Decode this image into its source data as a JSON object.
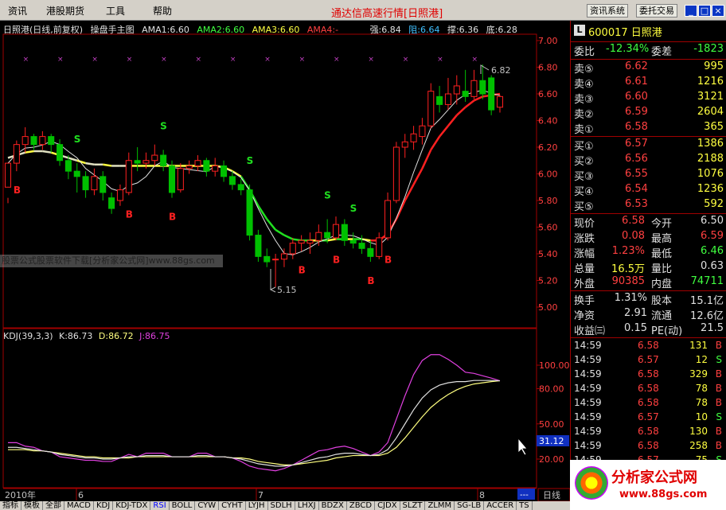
{
  "menu": {
    "items": [
      "资讯",
      "港股期货",
      "工具",
      "帮助"
    ],
    "title": "通达信高速行情[日照港]",
    "buttons": [
      "资讯系统",
      "委托交易"
    ],
    "win": [
      "_",
      "□",
      "×"
    ]
  },
  "header": {
    "name": "日照港(日线,前复权)",
    "indicator": "操盘手主图",
    "ama1": "AMA1:6.60",
    "ama2": "AMA2:6.60",
    "ama3": "AMA3:6.60",
    "ama4": "AMA4:-",
    "strong": "强:6.84",
    "resist": "阻:6.64",
    "support": "撑:6.36",
    "bottom": "底:6.28"
  },
  "watermark": "股票公式股票软件下载[分析家公式网]www.88gs.com",
  "kdj": {
    "name": "KDJ(39,3,3)",
    "k": "K:86.73",
    "d": "D:86.72",
    "j": "J:86.75"
  },
  "price_axis": [
    "7.00",
    "6.80",
    "6.60",
    "6.40",
    "6.20",
    "6.00",
    "5.80",
    "5.60",
    "5.40",
    "5.20",
    "5.00"
  ],
  "kdj_axis": [
    "100.00",
    "80.00",
    "50.00",
    "20.00"
  ],
  "kdj_readout": "31.12",
  "date_axis": [
    "2010年",
    "6",
    "7",
    "8"
  ],
  "annotations": {
    "high": "6.82",
    "low": "5.15"
  },
  "period_label": "日线",
  "more_label": "---",
  "tabs": [
    "指标",
    "模板",
    "全部",
    "MACD",
    "KDJ",
    "KDJ-TDX",
    "RSI",
    "BOLL",
    "CYW",
    "CYHT",
    "LYJH",
    "SDLH",
    "LHXJ",
    "BDZX",
    "ZBCD",
    "CJDX",
    "SLZT",
    "ZLMM",
    "SG-LB",
    "ACCER",
    "TS"
  ],
  "stock": {
    "logo": "L",
    "code_name": "600017 日照港"
  },
  "weibi": {
    "l1": "委比",
    "v1": "-12.34%",
    "l2": "委差",
    "v2": "-1823"
  },
  "sell": [
    {
      "label": "卖⑤",
      "price": "6.62",
      "vol": "995"
    },
    {
      "label": "卖④",
      "price": "6.61",
      "vol": "1216"
    },
    {
      "label": "卖③",
      "price": "6.60",
      "vol": "3121"
    },
    {
      "label": "卖②",
      "price": "6.59",
      "vol": "2604"
    },
    {
      "label": "卖①",
      "price": "6.58",
      "vol": "365"
    }
  ],
  "buy": [
    {
      "label": "买①",
      "price": "6.57",
      "vol": "1386"
    },
    {
      "label": "买②",
      "price": "6.56",
      "vol": "2188"
    },
    {
      "label": "买③",
      "price": "6.55",
      "vol": "1076"
    },
    {
      "label": "买④",
      "price": "6.54",
      "vol": "1236"
    },
    {
      "label": "买⑤",
      "price": "6.53",
      "vol": "592"
    }
  ],
  "quote": [
    {
      "l1": "现价",
      "v1": "6.58",
      "c1": "#ff4040",
      "l2": "今开",
      "v2": "6.50",
      "c2": "#e0e0e0"
    },
    {
      "l1": "涨跌",
      "v1": "0.08",
      "c1": "#ff4040",
      "l2": "最高",
      "v2": "6.59",
      "c2": "#ff4040"
    },
    {
      "l1": "涨幅",
      "v1": "1.23%",
      "c1": "#ff4040",
      "l2": "最低",
      "v2": "6.46",
      "c2": "#40ff40"
    },
    {
      "l1": "总量",
      "v1": "16.5万",
      "c1": "#ffff40",
      "l2": "量比",
      "v2": "0.63",
      "c2": "#e0e0e0"
    },
    {
      "l1": "外盘",
      "v1": "90385",
      "c1": "#ff4040",
      "l2": "内盘",
      "v2": "74711",
      "c2": "#40ff40"
    }
  ],
  "fund": [
    {
      "l1": "换手",
      "v1": "1.31%",
      "l2": "股本",
      "v2": "15.1亿"
    },
    {
      "l1": "净资",
      "v1": "2.91",
      "l2": "流通",
      "v2": "12.6亿"
    },
    {
      "l1": "收益㈢",
      "v1": "0.15",
      "l2": "PE(动)",
      "v2": "21.5"
    }
  ],
  "ticks": [
    {
      "t": "14:59",
      "p": "6.58",
      "v": "131",
      "s": "B"
    },
    {
      "t": "14:59",
      "p": "6.57",
      "v": "12",
      "s": "S"
    },
    {
      "t": "14:59",
      "p": "6.58",
      "v": "329",
      "s": "B"
    },
    {
      "t": "14:59",
      "p": "6.58",
      "v": "78",
      "s": "B"
    },
    {
      "t": "14:59",
      "p": "6.58",
      "v": "78",
      "s": "B"
    },
    {
      "t": "14:59",
      "p": "6.57",
      "v": "10",
      "s": "S"
    },
    {
      "t": "14:59",
      "p": "6.58",
      "v": "130",
      "s": "B"
    },
    {
      "t": "14:59",
      "p": "6.58",
      "v": "258",
      "s": "B"
    },
    {
      "t": "14:59",
      "p": "6.57",
      "v": "75",
      "s": "S"
    }
  ],
  "logo": {
    "t1": "分析家公式网",
    "t2": "www.88gs.com"
  },
  "colors": {
    "up": "#ff2020",
    "down": "#00c000",
    "ama": "#ffff40",
    "bg": "#000000"
  },
  "chart_data": {
    "type": "candlestick",
    "ylim": [
      4.9,
      7.1
    ],
    "candles": [
      [
        5.9,
        6.08,
        5.82,
        5.78
      ],
      [
        6.08,
        6.22,
        6.25,
        6.02
      ],
      [
        6.22,
        6.28,
        6.35,
        6.16
      ],
      [
        6.28,
        6.22,
        6.3,
        6.18
      ],
      [
        6.22,
        6.28,
        6.32,
        6.18
      ],
      [
        6.28,
        6.22,
        6.3,
        6.16
      ],
      [
        6.22,
        6.1,
        6.26,
        6.06
      ],
      [
        6.1,
        6.02,
        6.14,
        5.96
      ],
      [
        6.02,
        5.98,
        6.08,
        5.86
      ],
      [
        5.98,
        5.88,
        6.02,
        5.82
      ],
      [
        5.88,
        5.98,
        6.04,
        5.84
      ],
      [
        5.98,
        5.86,
        6.02,
        5.8
      ],
      [
        5.82,
        5.74,
        5.86,
        5.7
      ],
      [
        5.8,
        5.88,
        5.92,
        5.76
      ],
      [
        5.86,
        6.1,
        6.16,
        5.84
      ],
      [
        6.1,
        6.08,
        6.2,
        6.02
      ],
      [
        6.08,
        6.1,
        6.16,
        6.04
      ],
      [
        6.1,
        6.14,
        6.22,
        6.06
      ],
      [
        6.14,
        6.06,
        6.18,
        6.02
      ],
      [
        6.06,
        5.86,
        6.1,
        5.82
      ],
      [
        5.88,
        6.04,
        6.08,
        5.86
      ],
      [
        6.04,
        6.06,
        6.1,
        6.0
      ],
      [
        6.06,
        6.1,
        6.14,
        6.02
      ],
      [
        6.1,
        6.02,
        6.12,
        5.98
      ],
      [
        6.02,
        6.06,
        6.12,
        5.98
      ],
      [
        6.06,
        5.98,
        6.1,
        5.94
      ],
      [
        5.98,
        5.92,
        6.02,
        5.88
      ],
      [
        5.92,
        5.88,
        5.96,
        5.84
      ],
      [
        5.88,
        5.54,
        5.92,
        5.5
      ],
      [
        5.54,
        5.38,
        5.58,
        5.34
      ],
      [
        5.38,
        5.34,
        5.44,
        5.3
      ],
      [
        5.36,
        5.36,
        5.4,
        5.15
      ],
      [
        5.36,
        5.4,
        5.44,
        5.3
      ],
      [
        5.4,
        5.48,
        5.52,
        5.36
      ],
      [
        5.48,
        5.5,
        5.54,
        5.42
      ],
      [
        5.48,
        5.5,
        5.56,
        5.4
      ],
      [
        5.5,
        5.56,
        5.62,
        5.46
      ],
      [
        5.56,
        5.52,
        5.66,
        5.48
      ],
      [
        5.52,
        5.62,
        5.68,
        5.5
      ],
      [
        5.62,
        5.5,
        5.66,
        5.46
      ],
      [
        5.5,
        5.48,
        5.56,
        5.44
      ],
      [
        5.48,
        5.44,
        5.54,
        5.4
      ],
      [
        5.44,
        5.38,
        5.5,
        5.34
      ],
      [
        5.38,
        5.52,
        5.56,
        5.36
      ],
      [
        5.52,
        5.8,
        5.86,
        5.5
      ],
      [
        5.8,
        6.2,
        6.24,
        5.78
      ],
      [
        6.2,
        6.24,
        6.3,
        6.12
      ],
      [
        6.24,
        6.3,
        6.36,
        6.18
      ],
      [
        6.28,
        6.36,
        6.42,
        6.22
      ],
      [
        6.36,
        6.62,
        6.68,
        6.34
      ],
      [
        6.58,
        6.52,
        6.66,
        6.46
      ],
      [
        6.52,
        6.6,
        6.72,
        6.48
      ],
      [
        6.6,
        6.66,
        6.74,
        6.52
      ],
      [
        6.62,
        6.58,
        6.78,
        6.54
      ],
      [
        6.58,
        6.7,
        6.78,
        6.56
      ],
      [
        6.7,
        6.6,
        6.82,
        6.56
      ],
      [
        6.72,
        6.48,
        6.74,
        6.44
      ],
      [
        6.5,
        6.58,
        6.59,
        6.46
      ]
    ],
    "ama_values": [
      6.12,
      6.14,
      6.16,
      6.17,
      6.17,
      6.16,
      6.14,
      6.12,
      6.1,
      6.08,
      6.07,
      6.07,
      6.06,
      6.06,
      6.06,
      6.06,
      6.06,
      6.06,
      6.06,
      6.06,
      6.06,
      6.06,
      6.06,
      6.06,
      6.06,
      6.05,
      6.02,
      5.98,
      5.88,
      5.76,
      5.66,
      5.58,
      5.54,
      5.51,
      5.5,
      5.5,
      5.5,
      5.5,
      5.51,
      5.51,
      5.51,
      5.51,
      5.5,
      5.5,
      5.55,
      5.66,
      5.8,
      5.92,
      6.04,
      6.18,
      6.28,
      6.36,
      6.44,
      6.5,
      6.55,
      6.58,
      6.59,
      6.6
    ],
    "kdj_k": [
      30,
      30,
      29,
      28,
      27,
      26,
      24,
      23,
      22,
      21,
      21,
      20,
      20,
      21,
      22,
      22,
      23,
      23,
      23,
      22,
      22,
      22,
      23,
      23,
      22,
      22,
      21,
      20,
      18,
      16,
      15,
      14,
      14,
      15,
      17,
      19,
      21,
      22,
      24,
      25,
      25,
      24,
      23,
      24,
      28,
      38,
      50,
      62,
      72,
      79,
      83,
      85,
      86,
      86,
      87,
      87,
      87,
      86.73
    ],
    "kdj_d": [
      28,
      28,
      28,
      27,
      27,
      26,
      25,
      24,
      23,
      22,
      22,
      21,
      21,
      21,
      21,
      22,
      22,
      22,
      22,
      22,
      22,
      22,
      22,
      22,
      22,
      22,
      21,
      21,
      20,
      18,
      17,
      16,
      15,
      15,
      16,
      17,
      18,
      19,
      21,
      22,
      23,
      23,
      23,
      23,
      25,
      30,
      38,
      47,
      56,
      64,
      70,
      75,
      79,
      82,
      84,
      85,
      86,
      86.72
    ],
    "kdj_j": [
      34,
      34,
      31,
      30,
      27,
      26,
      22,
      21,
      20,
      19,
      19,
      18,
      18,
      21,
      24,
      22,
      25,
      25,
      25,
      22,
      22,
      22,
      25,
      25,
      22,
      22,
      21,
      18,
      14,
      12,
      11,
      10,
      12,
      15,
      19,
      23,
      27,
      28,
      30,
      31,
      29,
      26,
      23,
      26,
      34,
      54,
      74,
      92,
      104,
      109,
      109,
      105,
      100,
      94,
      93,
      91,
      89,
      86.75
    ],
    "signals": [
      {
        "i": 1,
        "type": "B",
        "at": "low"
      },
      {
        "i": 8,
        "type": "S",
        "at": "high"
      },
      {
        "i": 14,
        "type": "B",
        "at": "low"
      },
      {
        "i": 18,
        "type": "S",
        "at": "high"
      },
      {
        "i": 19,
        "type": "B",
        "at": "low"
      },
      {
        "i": 28,
        "type": "S",
        "at": "high"
      },
      {
        "i": 34,
        "type": "B",
        "at": "low"
      },
      {
        "i": 37,
        "type": "S",
        "at": "high"
      },
      {
        "i": 38,
        "type": "B",
        "at": "low"
      },
      {
        "i": 40,
        "type": "S",
        "at": "high"
      },
      {
        "i": 42,
        "type": "B",
        "at": "low"
      },
      {
        "i": 44,
        "type": "B",
        "at": "low"
      }
    ]
  }
}
